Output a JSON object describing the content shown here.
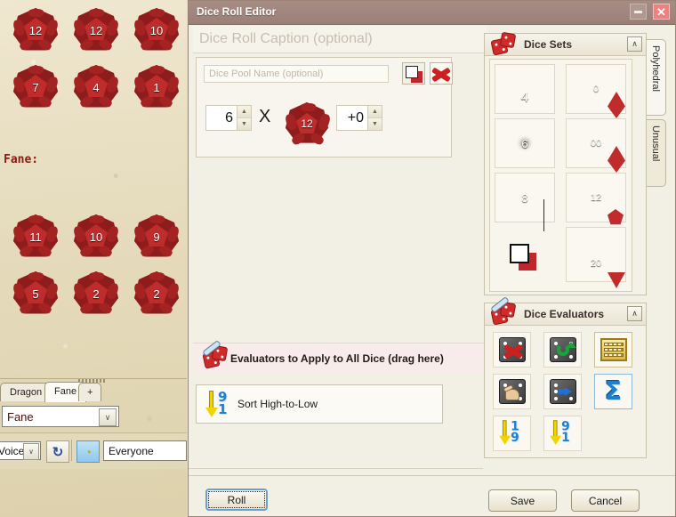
{
  "window": {
    "title": "Dice Roll Editor",
    "minimize_label": "_",
    "close_label": "✕"
  },
  "chat_panel": {
    "tray_label": "Fane:",
    "dice_rolls": [
      {
        "values": [
          "12",
          "12",
          "10"
        ]
      },
      {
        "values": [
          "7",
          "4",
          "1"
        ]
      }
    ],
    "dice_rolls_2": [
      {
        "values": [
          "11",
          "10",
          "9"
        ]
      },
      {
        "values": [
          "5",
          "2",
          "2"
        ]
      }
    ],
    "tabs": [
      {
        "label": "Dragon",
        "selected": false
      },
      {
        "label": "Fane",
        "selected": true
      },
      {
        "label": "+",
        "selected": false
      }
    ],
    "character_select": {
      "value": "Fane",
      "arrow": "∨"
    },
    "voice_select": {
      "value": "Voice",
      "arrow": "∨"
    },
    "refresh_icon": "↻",
    "speaker_icon": "◔",
    "recipient_field": {
      "value": "Everyone"
    }
  },
  "editor": {
    "caption_placeholder": "Dice Roll Caption (optional)",
    "pool": {
      "name_placeholder": "Dice Pool Name (optional)",
      "quantity": "6",
      "times_symbol": "X",
      "die_value": "12",
      "modifier": "+0",
      "spin_up": "▲",
      "spin_down": "▼"
    },
    "evaluator_drop": {
      "header": "Evaluators to Apply to All Dice (drag here)",
      "items": [
        {
          "label": "Sort High-to-Low",
          "top_digit": "9",
          "bottom_digit": "1"
        }
      ]
    },
    "buttons": {
      "roll": "Roll",
      "save": "Save",
      "cancel": "Cancel"
    }
  },
  "dice_sets": {
    "title": "Dice Sets",
    "collapse_icon": "∧",
    "tabs": [
      {
        "label": "Polyhedral",
        "selected": true
      },
      {
        "label": "Unusual",
        "selected": false
      }
    ],
    "items": [
      {
        "name": "d4",
        "face": "4",
        "shape": "d4"
      },
      {
        "name": "d10",
        "face": "0",
        "shape": "d10"
      },
      {
        "name": "d6",
        "face": "6",
        "shape": "d6"
      },
      {
        "name": "d100",
        "face": "00",
        "shape": "d10"
      },
      {
        "name": "d8",
        "face": "8",
        "shape": "d8"
      },
      {
        "name": "d12",
        "face": "12",
        "shape": "d12c"
      },
      {
        "name": "new-die",
        "face": "",
        "shape": "new"
      },
      {
        "name": "d20",
        "face": "20",
        "shape": "d20"
      }
    ]
  },
  "dice_evaluators": {
    "title": "Dice Evaluators",
    "collapse_icon": "∧",
    "items": [
      {
        "name": "drop-dice",
        "icon": "die-red-x"
      },
      {
        "name": "reroll-dice",
        "icon": "die-green-arrow"
      },
      {
        "name": "count-dice",
        "icon": "abacus"
      },
      {
        "name": "select-dice",
        "icon": "die-hand"
      },
      {
        "name": "move-dice",
        "icon": "die-blue-arrow"
      },
      {
        "name": "sum-dice",
        "icon": "sigma"
      },
      {
        "name": "sort-low-to-high",
        "icon": "sort",
        "top_digit": "1",
        "bottom_digit": "9"
      },
      {
        "name": "sort-high-to-low",
        "icon": "sort",
        "top_digit": "9",
        "bottom_digit": "1"
      }
    ]
  }
}
